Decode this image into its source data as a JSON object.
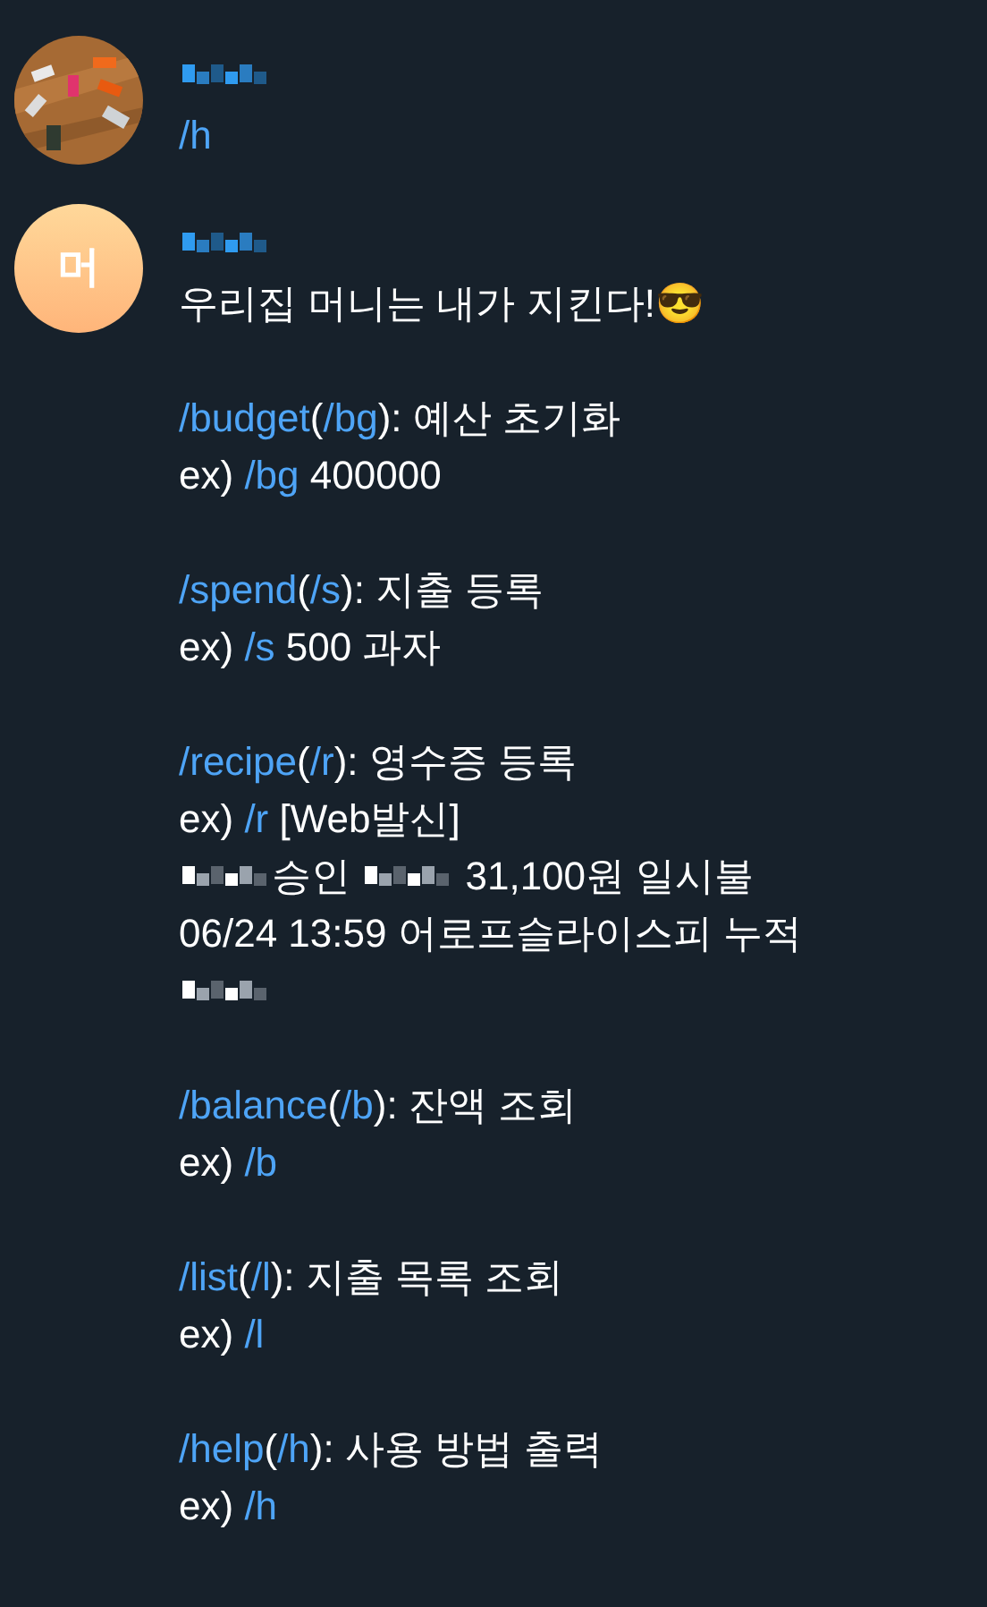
{
  "messages": [
    {
      "avatar": {
        "kind": "picture"
      },
      "sender": [
        {
          "kind": "mosaic"
        }
      ],
      "paragraphs": [
        [
          [
            {
              "kind": "command",
              "text": "/h"
            }
          ]
        ]
      ]
    },
    {
      "avatar": {
        "kind": "initial",
        "text": "머"
      },
      "sender": [
        {
          "kind": "mosaic"
        }
      ],
      "paragraphs": [
        [
          [
            {
              "kind": "plain",
              "text": "우리집 머니는 내가 지킨다!"
            },
            {
              "kind": "plain",
              "text": "😎"
            }
          ]
        ],
        [
          [
            {
              "kind": "command",
              "text": "/budget"
            },
            {
              "kind": "plain",
              "text": "("
            },
            {
              "kind": "command",
              "text": "/bg"
            },
            {
              "kind": "plain",
              "text": "): 예산 초기화"
            }
          ],
          [
            {
              "kind": "plain",
              "text": "ex) "
            },
            {
              "kind": "command",
              "text": "/bg"
            },
            {
              "kind": "plain",
              "text": " 400000"
            }
          ]
        ],
        [
          [
            {
              "kind": "command",
              "text": "/spend"
            },
            {
              "kind": "plain",
              "text": "("
            },
            {
              "kind": "command",
              "text": "/s"
            },
            {
              "kind": "plain",
              "text": "): 지출 등록"
            }
          ],
          [
            {
              "kind": "plain",
              "text": "ex) "
            },
            {
              "kind": "command",
              "text": "/s"
            },
            {
              "kind": "plain",
              "text": " 500 과자"
            }
          ]
        ],
        [
          [
            {
              "kind": "command",
              "text": "/recipe"
            },
            {
              "kind": "plain",
              "text": "("
            },
            {
              "kind": "command",
              "text": "/r"
            },
            {
              "kind": "plain",
              "text": "): 영수증 등록"
            }
          ],
          [
            {
              "kind": "plain",
              "text": "ex) "
            },
            {
              "kind": "command",
              "text": "/r"
            },
            {
              "kind": "plain",
              "text": " [Web발신]"
            }
          ],
          [
            {
              "kind": "mosaic"
            },
            {
              "kind": "plain",
              "text": "승인 "
            },
            {
              "kind": "mosaic"
            },
            {
              "kind": "plain",
              "text": " 31,100원 일시불"
            }
          ],
          [
            {
              "kind": "plain",
              "text": "06/24 13:59 어로프슬라이스피 누적"
            }
          ],
          [
            {
              "kind": "mosaic"
            }
          ]
        ],
        [
          [
            {
              "kind": "command",
              "text": "/balance"
            },
            {
              "kind": "plain",
              "text": "("
            },
            {
              "kind": "command",
              "text": "/b"
            },
            {
              "kind": "plain",
              "text": "): 잔액 조회"
            }
          ],
          [
            {
              "kind": "plain",
              "text": "ex) "
            },
            {
              "kind": "command",
              "text": "/b"
            }
          ]
        ],
        [
          [
            {
              "kind": "command",
              "text": "/list"
            },
            {
              "kind": "plain",
              "text": "("
            },
            {
              "kind": "command",
              "text": "/l"
            },
            {
              "kind": "plain",
              "text": "): 지출 목록 조회"
            }
          ],
          [
            {
              "kind": "plain",
              "text": "ex) "
            },
            {
              "kind": "command",
              "text": "/l"
            }
          ]
        ],
        [
          [
            {
              "kind": "command",
              "text": "/help"
            },
            {
              "kind": "plain",
              "text": "("
            },
            {
              "kind": "command",
              "text": "/h"
            },
            {
              "kind": "plain",
              "text": "): 사용 방법 출력"
            }
          ],
          [
            {
              "kind": "plain",
              "text": "ex) "
            },
            {
              "kind": "command",
              "text": "/h"
            }
          ]
        ]
      ]
    }
  ]
}
